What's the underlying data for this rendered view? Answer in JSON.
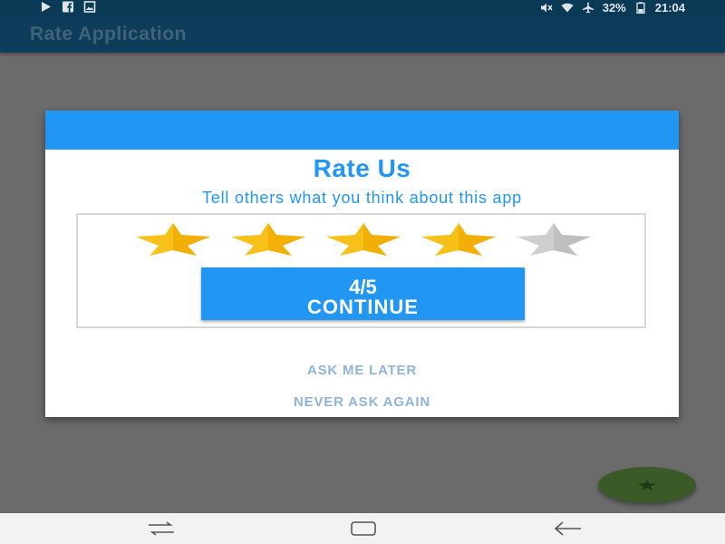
{
  "status_bar": {
    "battery": "32%",
    "time": "21:04",
    "left_icons": [
      "play-store-icon",
      "facebook-icon",
      "gallery-icon"
    ],
    "right_icons": [
      "mute-icon",
      "wifi-icon",
      "airplane-icon",
      "battery-icon"
    ]
  },
  "app_bar": {
    "title": "Rate Application"
  },
  "dialog": {
    "title": "Rate Us",
    "subtitle": "Tell others what you think about this app",
    "rating": 4,
    "max_rating": 5,
    "score_text": "4/5",
    "continue_label": "CONTINUE",
    "ask_later_label": "ASK ME LATER",
    "never_ask_label": "NEVER ASK AGAIN"
  },
  "fab": {
    "icon": "star-icon"
  },
  "nav_bar": {
    "icons": [
      "recent-apps-icon",
      "home-icon",
      "back-icon"
    ]
  },
  "colors": {
    "accent": "#2196f3",
    "app_bar": "#0d3d5a",
    "star_active": "#f8c11a",
    "star_inactive": "#cfcfcf",
    "fab": "#3a5a27",
    "link": "#90b4d8"
  }
}
